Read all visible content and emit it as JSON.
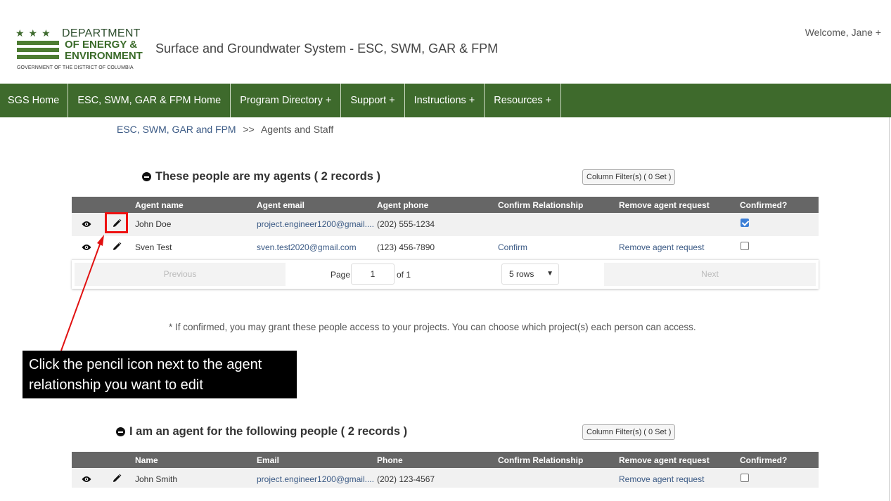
{
  "header": {
    "logo": {
      "line1": "DEPARTMENT",
      "line2": "OF ENERGY &",
      "line3": "ENVIRONMENT",
      "subtitle": "GOVERNMENT OF THE DISTRICT OF COLUMBIA"
    },
    "system_title": "Surface and Groundwater System - ESC, SWM, GAR & FPM",
    "welcome": "Welcome, Jane +"
  },
  "nav": {
    "items": [
      {
        "label": "SGS Home"
      },
      {
        "label": "ESC, SWM, GAR & FPM Home"
      },
      {
        "label": "Program Directory +"
      },
      {
        "label": "Support +"
      },
      {
        "label": "Instructions +"
      },
      {
        "label": "Resources +"
      }
    ]
  },
  "breadcrumb": {
    "link": "ESC, SWM, GAR and FPM",
    "separator": ">>",
    "current": "Agents and Staff"
  },
  "my_agents": {
    "title": "These people are my agents ( 2 records )",
    "filter_button": "Column Filter(s) ( 0 Set )",
    "columns": [
      "Agent name",
      "Agent email",
      "Agent phone",
      "Confirm Relationship",
      "Remove agent request",
      "Confirmed?"
    ],
    "rows": [
      {
        "name": "John Doe",
        "email": "project.engineer1200@gmail....",
        "phone": "(202) 555-1234",
        "confirm": "",
        "remove": "",
        "confirmed": true
      },
      {
        "name": "Sven Test",
        "email": "sven.test2020@gmail.com",
        "phone": "(123) 456-7890",
        "confirm": "Confirm",
        "remove": "Remove agent request",
        "confirmed": false
      }
    ],
    "pager": {
      "previous": "Previous",
      "page_label": "Page",
      "page_value": "1",
      "of_label": "of 1",
      "rows_select": "5 rows",
      "next": "Next"
    }
  },
  "note": "* If confirmed, you may grant these people access to your projects. You can choose which project(s) each person can access.",
  "callout": {
    "line1": "Click the pencil icon next to the agent",
    "line2": "relationship you want to edit",
    "arrow_color": "#e11111"
  },
  "agent_for": {
    "title": "I am an agent for the following people ( 2 records )",
    "filter_button": "Column Filter(s) ( 0 Set )",
    "columns": [
      "Name",
      "Email",
      "Phone",
      "Confirm Relationship",
      "Remove agent request",
      "Confirmed?"
    ],
    "rows": [
      {
        "name": "John Smith",
        "email": "project.engineer1200@gmail....",
        "phone": "(202) 123-4567",
        "confirm": "",
        "remove": "Remove agent request",
        "confirmed": false
      }
    ]
  },
  "colors": {
    "nav_green": "#3e6a2c",
    "table_header": "#666666",
    "link_blue": "#3b5a85",
    "highlight_red": "#e11111"
  }
}
